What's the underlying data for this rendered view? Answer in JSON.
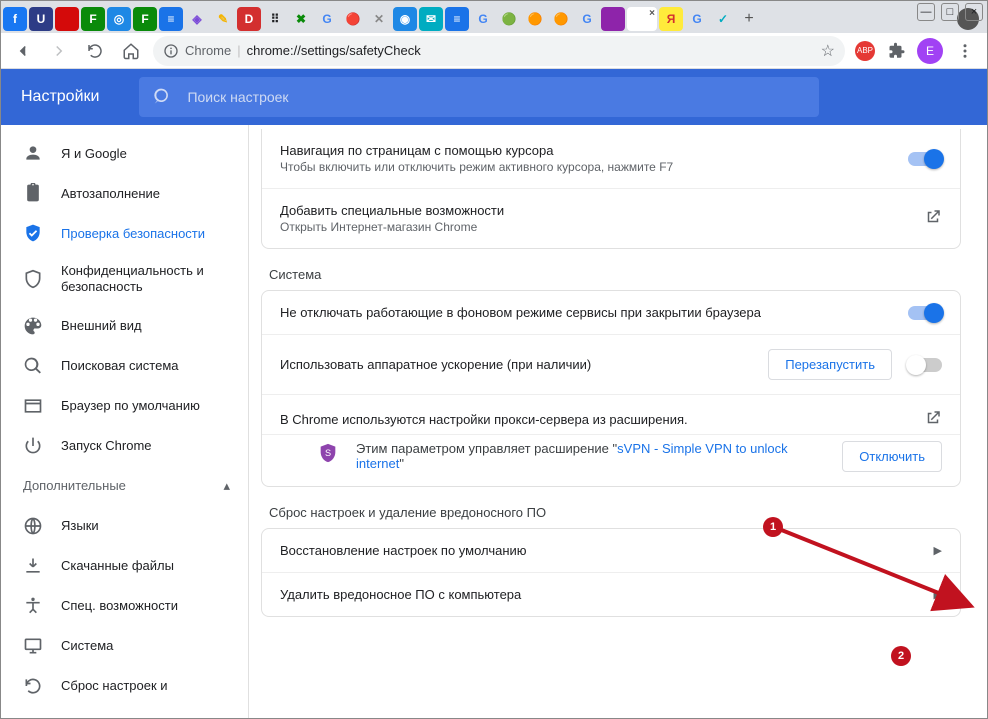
{
  "window": {
    "minimize": "—",
    "maximize": "□",
    "close": "×"
  },
  "toolbar": {
    "chrome_label": "Chrome",
    "url": "chrome://settings/safetyCheck",
    "avatar_initial": "Е"
  },
  "header": {
    "title": "Настройки",
    "search_placeholder": "Поиск настроек"
  },
  "sidebar": {
    "items": [
      {
        "label": "Я и Google"
      },
      {
        "label": "Автозаполнение"
      },
      {
        "label": "Проверка безопасности"
      },
      {
        "label": "Конфиденциальность и безопасность"
      },
      {
        "label": "Внешний вид"
      },
      {
        "label": "Поисковая система"
      },
      {
        "label": "Браузер по умолчанию"
      },
      {
        "label": "Запуск Chrome"
      }
    ],
    "advanced_label": "Дополнительные",
    "adv_items": [
      {
        "label": "Языки"
      },
      {
        "label": "Скачанные файлы"
      },
      {
        "label": "Спец. возможности"
      },
      {
        "label": "Система"
      },
      {
        "label": "Сброс настроек и"
      }
    ]
  },
  "settings": {
    "cursor_nav": {
      "title": "Навигация по страницам с помощью курсора",
      "sub": "Чтобы включить или отключить режим активного курсора, нажмите F7"
    },
    "add_a11y": {
      "title": "Добавить специальные возможности",
      "sub": "Открыть Интернет-магазин Chrome"
    },
    "system_header": "Система",
    "bg": {
      "title": "Не отключать работающие в фоновом режиме сервисы при закрытии браузера"
    },
    "hw": {
      "title": "Использовать аппаратное ускорение (при наличии)",
      "restart": "Перезапустить"
    },
    "proxy": {
      "title": "В Chrome используются настройки прокси-сервера из расширения.",
      "managed_prefix": "Этим параметром управляет расширение \"",
      "ext_name": "sVPN - Simple VPN to unlock internet",
      "managed_suffix": "\"",
      "disable": "Отключить"
    },
    "reset_header": "Сброс настроек и удаление вредоносного ПО",
    "restore": {
      "title": "Восстановление настроек по умолчанию"
    },
    "cleanup": {
      "title": "Удалить вредоносное ПО с компьютера"
    }
  },
  "annotation": {
    "b1": "1",
    "b2": "2"
  }
}
